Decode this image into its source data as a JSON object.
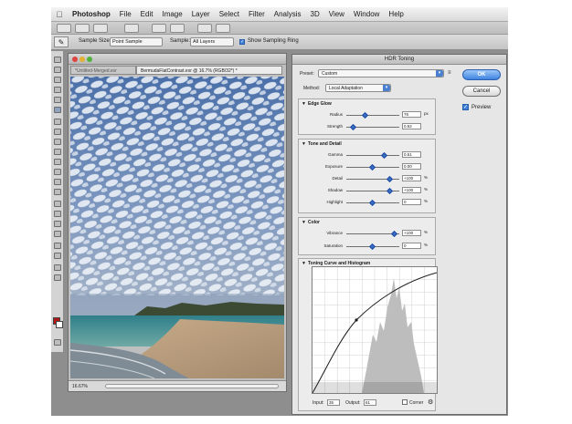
{
  "menubar": {
    "app_name": "Photoshop",
    "items": [
      "File",
      "Edit",
      "Image",
      "Layer",
      "Select",
      "Filter",
      "Analysis",
      "3D",
      "View",
      "Window",
      "Help"
    ]
  },
  "options_bar": {
    "sample_size_label": "Sample Size:",
    "sample_size_value": "Point Sample",
    "sample_label": "Sample:",
    "sample_value": "All Layers",
    "show_ring_label": "Show Sampling Ring"
  },
  "document": {
    "title": "BermudaFlatContrast.exr @ 16.7% (RGB/32*) *",
    "inactive_tab": "*Untitled-Merged.exr",
    "active_tab": "BermudaFlatContrast.exr @ 16.7% (RGB/32*) *",
    "zoom": "16.67%"
  },
  "dialog": {
    "title": "HDR Toning",
    "preset_label": "Preset:",
    "preset_value": "Custom",
    "method_label": "Method:",
    "method_value": "Local Adaptation",
    "ok_label": "OK",
    "cancel_label": "Cancel",
    "preview_label": "Preview",
    "preview_checked": true,
    "edge_glow": {
      "title": "Edge Glow",
      "rows": [
        {
          "name": "Radius",
          "value": "76",
          "unit": "px",
          "level": 0.36
        },
        {
          "name": "Strength",
          "value": "0.52",
          "unit": "",
          "level": 0.14
        }
      ]
    },
    "tone_detail": {
      "title": "Tone and Detail",
      "rows": [
        {
          "name": "Gamma",
          "value": "0.51",
          "unit": "",
          "level": 0.72
        },
        {
          "name": "Exposure",
          "value": "0.00",
          "unit": "",
          "level": 0.5
        },
        {
          "name": "Detail",
          "value": "+100",
          "unit": "%",
          "level": 0.82
        },
        {
          "name": "Shadow",
          "value": "+100",
          "unit": "%",
          "level": 0.82
        },
        {
          "name": "Highlight",
          "value": "0",
          "unit": "%",
          "level": 0.5
        }
      ]
    },
    "color": {
      "title": "Color",
      "rows": [
        {
          "name": "Vibrance",
          "value": "+100",
          "unit": "%",
          "level": 0.92
        },
        {
          "name": "Saturation",
          "value": "0",
          "unit": "%",
          "level": 0.5
        }
      ]
    },
    "curve": {
      "title": "Toning Curve and Histogram",
      "input_label": "Input:",
      "input_value": "35",
      "output_label": "Output:",
      "output_value": "61",
      "corner_label": "Corner"
    }
  },
  "colors": {
    "foreground": "#b31616",
    "accent": "#3e80da"
  }
}
